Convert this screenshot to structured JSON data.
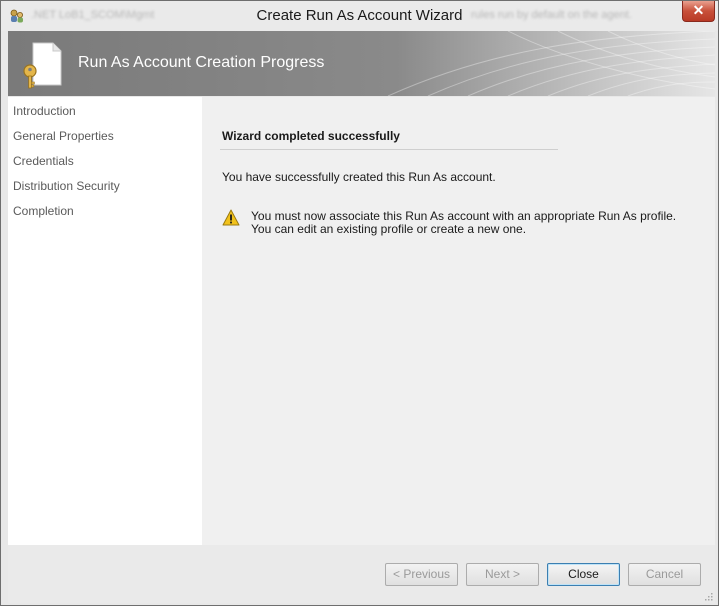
{
  "window": {
    "title": "Create Run As Account Wizard",
    "close_glyph": "✕",
    "background_blur": [
      ".NET LoB1_SCOM\\Mgmt",
      "rules run by default on the agent."
    ]
  },
  "header": {
    "title": "Run As Account Creation Progress",
    "icon": "document-key-icon"
  },
  "nav": {
    "items": [
      {
        "label": "Introduction"
      },
      {
        "label": "General Properties"
      },
      {
        "label": "Credentials"
      },
      {
        "label": "Distribution Security"
      },
      {
        "label": "Completion"
      }
    ]
  },
  "content": {
    "heading": "Wizard completed successfully",
    "success_message": "You have successfully created this Run As account.",
    "warning_icon": "warning-icon",
    "warning_line1": "You must now associate this Run As account with an appropriate Run As profile.",
    "warning_line2": "You can edit an existing profile or create a new one."
  },
  "footer": {
    "buttons": {
      "previous": {
        "label": "< Previous",
        "enabled": false
      },
      "next": {
        "label": "Next >",
        "enabled": false
      },
      "close": {
        "label": "Close",
        "enabled": true
      },
      "cancel": {
        "label": "Cancel",
        "enabled": false
      }
    }
  },
  "colors": {
    "header_bg": "#7e7e7e",
    "close_button": "#c8503a",
    "active_button_border": "#3c7fb1",
    "warning": "#f2c21b"
  }
}
